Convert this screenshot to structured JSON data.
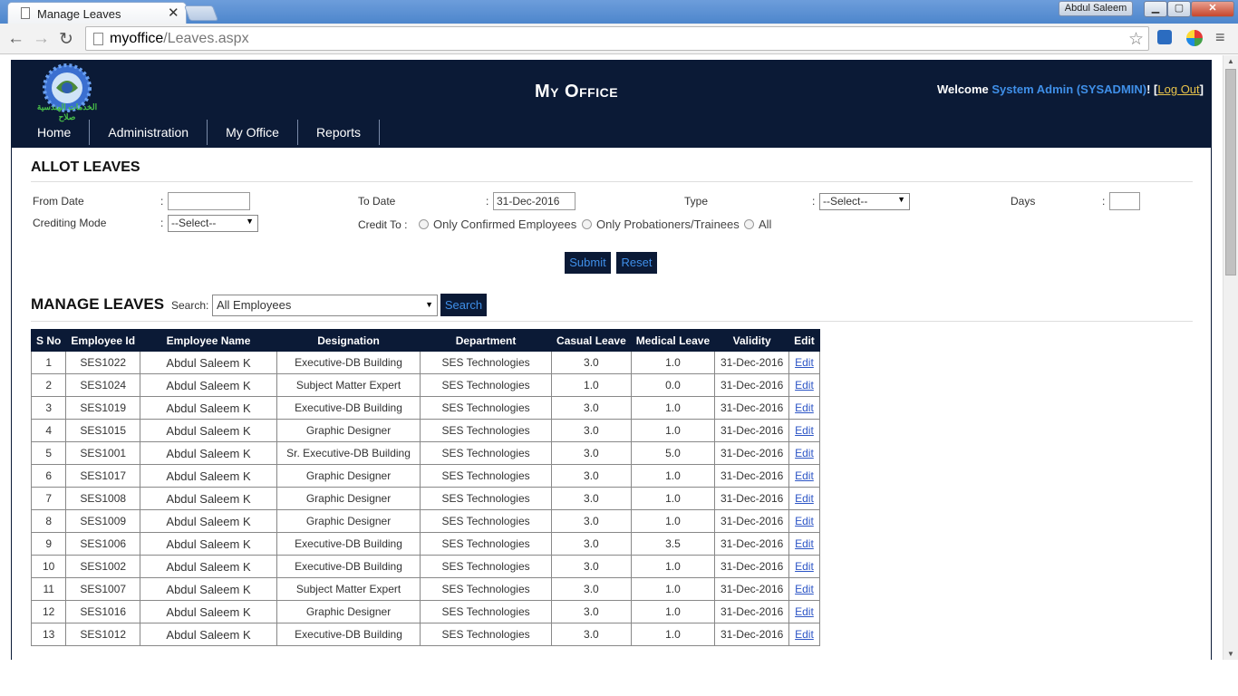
{
  "browser": {
    "tab_title": "Manage Leaves",
    "tab_close": "✕",
    "user_badge": "Abdul Saleem",
    "window_min": "▁",
    "window_max": "▢",
    "window_close": "✕",
    "back": "←",
    "forward": "→",
    "reload": "↻",
    "url_host": "myoffice",
    "url_path": "/Leaves.aspx",
    "star": "☆",
    "menu": "≡",
    "scroll_up": "▲",
    "scroll_down": "▼"
  },
  "header": {
    "title": "My Office",
    "logo_text": "الخدمات الهندسية صلاح",
    "welcome_prefix": "Welcome ",
    "user_name": "System Admin (SYSADMIN)",
    "bracket_open": "! [",
    "logout": "Log Out",
    "bracket_close": "]"
  },
  "menu": {
    "items": [
      "Home",
      "Administration",
      "My Office",
      "Reports"
    ]
  },
  "allot": {
    "title": "ALLOT LEAVES",
    "colon": ":",
    "from_date_label": "From Date",
    "from_date_value": "",
    "to_date_label": "To Date",
    "to_date_value": "31-Dec-2016",
    "type_label": "Type",
    "type_value": "--Select--",
    "days_label": "Days",
    "days_value": "",
    "crediting_mode_label": "Crediting Mode",
    "crediting_mode_value": "--Select--",
    "credit_to_label": "Credit To :",
    "credit_options": [
      "Only Confirmed Employees",
      "Only Probationers/Trainees",
      "All"
    ],
    "submit": "Submit",
    "reset": "Reset"
  },
  "manage": {
    "title": "MANAGE LEAVES",
    "search_label": "Search:",
    "search_value": "All Employees",
    "search_button": "Search"
  },
  "table": {
    "columns": [
      "S No",
      "Employee Id",
      "Employee Name",
      "Designation",
      "Department",
      "Casual Leave",
      "Medical Leave",
      "Validity",
      "Edit"
    ],
    "rows": [
      [
        "1",
        "SES1022",
        "Abdul Saleem K",
        "Executive-DB Building",
        "SES Technologies",
        "3.0",
        "1.0",
        "31-Dec-2016",
        "Edit"
      ],
      [
        "2",
        "SES1024",
        "Abdul Saleem K",
        "Subject Matter Expert",
        "SES Technologies",
        "1.0",
        "0.0",
        "31-Dec-2016",
        "Edit"
      ],
      [
        "3",
        "SES1019",
        "Abdul Saleem K",
        "Executive-DB Building",
        "SES Technologies",
        "3.0",
        "1.0",
        "31-Dec-2016",
        "Edit"
      ],
      [
        "4",
        "SES1015",
        "Abdul Saleem K",
        "Graphic Designer",
        "SES Technologies",
        "3.0",
        "1.0",
        "31-Dec-2016",
        "Edit"
      ],
      [
        "5",
        "SES1001",
        "Abdul Saleem K",
        "Sr. Executive-DB Building",
        "SES Technologies",
        "3.0",
        "5.0",
        "31-Dec-2016",
        "Edit"
      ],
      [
        "6",
        "SES1017",
        "Abdul Saleem K",
        "Graphic Designer",
        "SES Technologies",
        "3.0",
        "1.0",
        "31-Dec-2016",
        "Edit"
      ],
      [
        "7",
        "SES1008",
        "Abdul Saleem K",
        "Graphic Designer",
        "SES Technologies",
        "3.0",
        "1.0",
        "31-Dec-2016",
        "Edit"
      ],
      [
        "8",
        "SES1009",
        "Abdul Saleem K",
        "Graphic Designer",
        "SES Technologies",
        "3.0",
        "1.0",
        "31-Dec-2016",
        "Edit"
      ],
      [
        "9",
        "SES1006",
        "Abdul Saleem K",
        "Executive-DB Building",
        "SES Technologies",
        "3.0",
        "3.5",
        "31-Dec-2016",
        "Edit"
      ],
      [
        "10",
        "SES1002",
        "Abdul Saleem K",
        "Executive-DB Building",
        "SES Technologies",
        "3.0",
        "1.0",
        "31-Dec-2016",
        "Edit"
      ],
      [
        "11",
        "SES1007",
        "Abdul Saleem K",
        "Subject Matter Expert",
        "SES Technologies",
        "3.0",
        "1.0",
        "31-Dec-2016",
        "Edit"
      ],
      [
        "12",
        "SES1016",
        "Abdul Saleem K",
        "Graphic Designer",
        "SES Technologies",
        "3.0",
        "1.0",
        "31-Dec-2016",
        "Edit"
      ],
      [
        "13",
        "SES1012",
        "Abdul Saleem K",
        "Executive-DB Building",
        "SES Technologies",
        "3.0",
        "1.0",
        "31-Dec-2016",
        "Edit"
      ]
    ]
  },
  "colors": {
    "navy": "#0b1a36",
    "link_blue": "#3f8fe8",
    "logout_gold": "#e8c34a",
    "edit_link": "#2c55c6"
  }
}
